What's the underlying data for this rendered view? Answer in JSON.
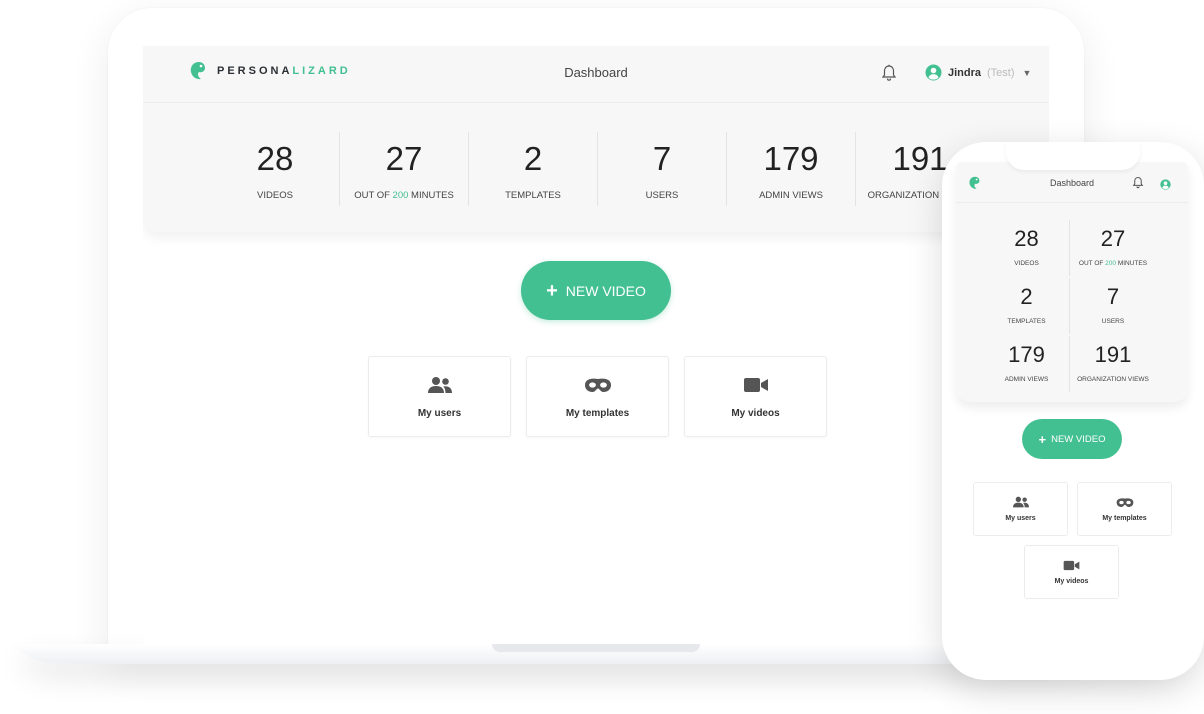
{
  "brand": {
    "name_prefix": "PERSONA",
    "name_suffix": "LIZARD",
    "accent_color": "#43c091"
  },
  "header": {
    "title": "Dashboard",
    "user_name": "Jindra",
    "user_role": "(Test)",
    "icons": [
      "bell-icon",
      "user-circle-icon",
      "caret-down-icon"
    ]
  },
  "stats": [
    {
      "value": "28",
      "label": "VIDEOS"
    },
    {
      "value": "27",
      "label_prefix": "OUT OF ",
      "label_highlight": "200",
      "label_suffix": " MINUTES"
    },
    {
      "value": "2",
      "label": "TEMPLATES"
    },
    {
      "value": "7",
      "label": "USERS"
    },
    {
      "value": "179",
      "label": "ADMIN VIEWS"
    },
    {
      "value": "191",
      "label": "ORGANIZATION VIEWS"
    }
  ],
  "actions": {
    "new_video_label": "NEW VIDEO"
  },
  "tiles": [
    {
      "label": "My users",
      "icon": "users-icon"
    },
    {
      "label": "My templates",
      "icon": "mask-icon"
    },
    {
      "label": "My videos",
      "icon": "video-camera-icon"
    }
  ]
}
